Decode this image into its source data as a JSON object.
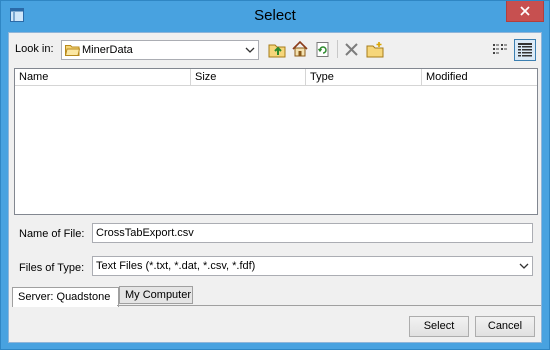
{
  "window": {
    "title": "Select"
  },
  "toolbar": {
    "look_in_label": "Look in:",
    "look_in_value": "MinerData"
  },
  "file_list": {
    "columns": [
      "Name",
      "Size",
      "Type",
      "Modified"
    ],
    "rows": []
  },
  "fields": {
    "name_label": "Name of File:",
    "name_value": "CrossTabExport.csv",
    "type_label": "Files of Type:",
    "type_value": "Text Files (*.txt, *.dat, *.csv, *.fdf)"
  },
  "tabs": [
    {
      "label": "Server: Quadstone",
      "active": true
    },
    {
      "label": "My Computer",
      "active": false
    }
  ],
  "buttons": {
    "select": "Select",
    "cancel": "Cancel"
  },
  "icons": {
    "app": "window-icon",
    "close": "close-icon",
    "folder": "folder-icon",
    "up": "up-folder-icon",
    "home": "home-icon",
    "refresh": "refresh-icon",
    "delete": "delete-icon",
    "new_folder": "new-folder-icon",
    "list_view": "list-view-icon",
    "details_view": "details-view-icon"
  },
  "colors": {
    "titlebar": "#48a2e0",
    "close": "#c75050",
    "client": "#f0f0f0"
  }
}
